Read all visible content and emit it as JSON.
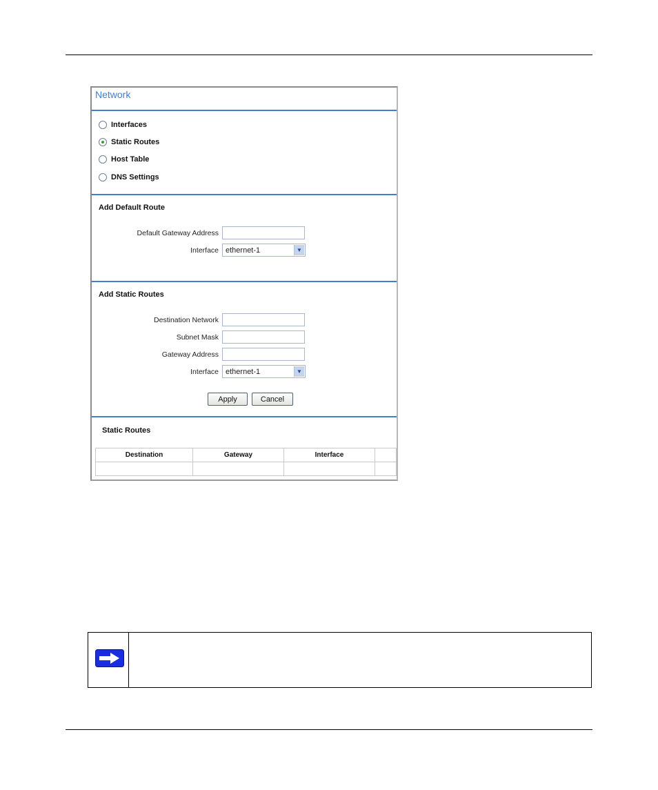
{
  "panel": {
    "title": "Network",
    "options": [
      {
        "label": "Interfaces",
        "selected": false
      },
      {
        "label": "Static Routes",
        "selected": true
      },
      {
        "label": "Host Table",
        "selected": false
      },
      {
        "label": "DNS Settings",
        "selected": false
      }
    ]
  },
  "default_route": {
    "title": "Add Default Route",
    "gateway_label": "Default Gateway Address",
    "gateway_value": "",
    "interface_label": "Interface",
    "interface_value": "ethernet-1"
  },
  "static_routes_form": {
    "title": "Add Static Routes",
    "destination_label": "Destination Network",
    "destination_value": "",
    "subnet_label": "Subnet Mask",
    "subnet_value": "",
    "gateway_label": "Gateway Address",
    "gateway_value": "",
    "interface_label": "Interface",
    "interface_value": "ethernet-1",
    "apply_label": "Apply",
    "cancel_label": "Cancel"
  },
  "static_routes_table": {
    "title": "Static Routes",
    "columns": [
      "Destination",
      "Gateway",
      "Interface",
      ""
    ],
    "rows": [
      [
        "",
        "",
        "",
        ""
      ]
    ]
  },
  "note": {
    "icon": "arrow-right-icon",
    "text": ""
  }
}
